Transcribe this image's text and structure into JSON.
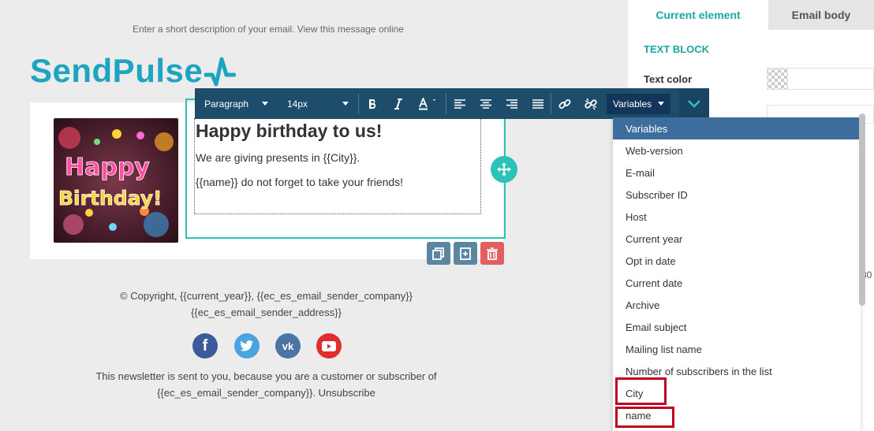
{
  "email": {
    "preheader": "Enter a short description of your email. View this message online",
    "logo_text": "SendPulse",
    "heading": "Happy birthday to us!",
    "paragraph1": "We are giving presents in {{City}}.",
    "paragraph2": "{{name}} do not forget to take your friends!",
    "image_words": [
      "Happy",
      "Birthday!"
    ],
    "footer_line1": "© Copyright, {{current_year}}, {{ec_es_email_sender_company}}",
    "footer_line2": "{{ec_es_email_sender_address}}",
    "footer_line3": "This newsletter is sent to you, because you are a customer or subscriber of",
    "footer_line4": "{{ec_es_email_sender_company}}. Unsubscribe",
    "social": [
      "facebook-icon",
      "twitter-icon",
      "vk-icon",
      "youtube-icon"
    ]
  },
  "toolbar": {
    "format": "Paragraph",
    "size": "14px",
    "variables_label": "Variables"
  },
  "panel": {
    "tab_current": "Current element",
    "tab_body": "Email body",
    "section_title": "TEXT BLOCK",
    "text_color_label": "Text color",
    "partial_value": "30"
  },
  "dropdown": {
    "items": [
      "Variables",
      "Web-version",
      "E-mail",
      "Subscriber ID",
      "Host",
      "Current year",
      "Opt in date",
      "Current date",
      "Archive",
      "Email subject",
      "Mailing list name",
      "Number of subscribers in the list",
      "City",
      "name"
    ],
    "selected": "Variables",
    "highlighted": [
      "City",
      "name"
    ]
  },
  "colors": {
    "accent_teal": "#2bc3b9",
    "toolbar_bg": "#1d4d6b",
    "dropdown_active": "#3c6d9c",
    "highlight_red": "#c0001f",
    "logo_blue": "#1ca4c0"
  }
}
